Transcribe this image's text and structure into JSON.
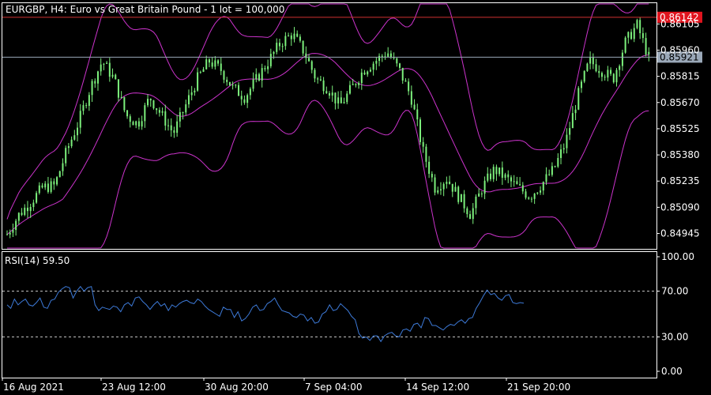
{
  "main_title": "EURGBP, H4:  Euro vs Great Britain Pound - 1 lot = 100,000",
  "rsi_title": "RSI(14) 59.50",
  "colors": {
    "background": "#000000",
    "frame": "#ffffff",
    "candle": "#7cf07c",
    "bollinger": "#cc33cc",
    "rsi_line": "#3d7ad8",
    "ask_line": "#d03030",
    "bid_line": "#9aa8b8",
    "ask_tag_bg": "#e0141e",
    "bid_tag_bg": "#9aa8b8"
  },
  "chart_data": [
    {
      "type": "candlestick",
      "symbol": "EURGBP",
      "timeframe": "H4",
      "title": "EURGBP, H4:  Euro vs Great Britain Pound - 1 lot = 100,000",
      "y_ticks": [
        "0.86105",
        "0.85960",
        "0.85815",
        "0.85670",
        "0.85525",
        "0.85380",
        "0.85235",
        "0.85090",
        "0.84945"
      ],
      "ylim": [
        0.8486,
        0.8622
      ],
      "ask_price": "0.86142",
      "bid_price": "0.85921",
      "x_ticks": [
        "16 Aug 2021",
        "23 Aug 12:00",
        "30 Aug 20:00",
        "7 Sep 04:00",
        "14 Sep 12:00",
        "21 Sep 20:00"
      ],
      "series_close_sample": [
        0.8494,
        0.8505,
        0.8512,
        0.852,
        0.8521,
        0.854,
        0.8556,
        0.8575,
        0.859,
        0.858,
        0.856,
        0.8555,
        0.857,
        0.856,
        0.855,
        0.8565,
        0.858,
        0.859,
        0.8585,
        0.8575,
        0.857,
        0.858,
        0.859,
        0.86,
        0.8605,
        0.8595,
        0.858,
        0.8575,
        0.8565,
        0.8575,
        0.8585,
        0.859,
        0.8595,
        0.8585,
        0.857,
        0.854,
        0.852,
        0.8525,
        0.8515,
        0.8505,
        0.852,
        0.853,
        0.8525,
        0.852,
        0.8515,
        0.8522,
        0.853,
        0.8545,
        0.857,
        0.859,
        0.8585,
        0.858,
        0.86,
        0.861,
        0.8592
      ]
    },
    {
      "type": "line",
      "indicator": "RSI(14)",
      "title": "RSI(14) 59.50",
      "y_ticks": [
        "100.00",
        "70.00",
        "30.00",
        "0.00"
      ],
      "ylim": [
        0,
        100
      ],
      "levels": [
        70,
        30
      ],
      "series": [
        {
          "values": [
            58,
            55,
            63,
            58,
            61,
            63,
            58,
            57,
            60,
            64,
            56,
            55,
            62,
            63,
            69,
            72,
            74,
            73,
            64,
            70,
            74,
            70,
            73,
            74,
            58,
            53,
            56,
            55,
            54,
            57,
            56,
            52,
            58,
            60,
            57,
            64,
            65,
            61,
            58,
            54,
            58,
            61,
            57,
            59,
            53,
            58,
            56,
            59,
            61,
            62,
            60,
            59,
            63,
            61,
            57,
            54,
            52,
            50,
            48,
            56,
            54,
            54,
            47,
            52,
            44,
            46,
            50,
            56,
            58,
            53,
            54,
            59,
            61,
            64,
            58,
            53,
            52,
            51,
            48,
            47,
            50,
            49,
            44,
            47,
            42,
            43,
            50,
            52,
            58,
            53,
            54,
            59,
            56,
            53,
            48,
            45,
            33,
            29,
            30,
            27,
            31,
            31,
            26,
            31,
            33,
            34,
            31,
            30,
            36,
            37,
            35,
            41,
            42,
            38,
            47,
            46,
            40,
            40,
            38,
            36,
            39,
            41,
            40,
            43,
            45,
            42,
            46,
            47,
            55,
            60,
            66,
            71,
            67,
            68,
            64,
            62,
            66,
            67,
            60,
            59,
            60,
            59.5
          ]
        }
      ]
    }
  ]
}
